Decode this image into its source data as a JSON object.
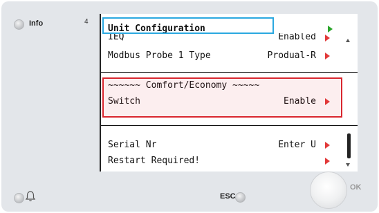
{
  "controls": {
    "info_label": "Info",
    "esc_label": "ESC",
    "ok_label": "OK"
  },
  "screen": {
    "page_number": "4",
    "header_title": "Unit Configuration",
    "rows": [
      {
        "label": "IEQ",
        "value": "Enabled",
        "arrow": "red"
      },
      {
        "label": "Modbus Probe 1 Type",
        "value": "Produal-R",
        "arrow": "red"
      },
      {
        "label": "~~~~~~ Comfort/Economy ~~~~~",
        "value": "",
        "arrow": "none"
      },
      {
        "label": "Switch",
        "value": "Enable",
        "arrow": "red"
      },
      {
        "label": "Serial Nr",
        "value": "Enter U",
        "arrow": "red"
      },
      {
        "label": "Restart Required!",
        "value": "",
        "arrow": "red"
      }
    ]
  },
  "colors": {
    "header_highlight": "#2aa8e0",
    "group_highlight": "#d9262e",
    "arrow_red": "#e23a3a",
    "arrow_green": "#2aa52a"
  },
  "icons": [
    "bell-icon",
    "info-led",
    "esc-led",
    "alarm-led"
  ]
}
